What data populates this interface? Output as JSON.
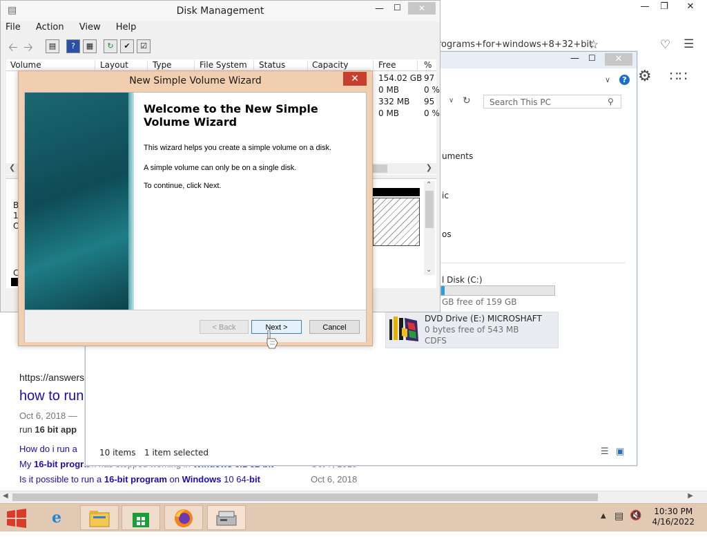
{
  "browser": {
    "address_tail": "rograms+for+windows+8+32+bit",
    "search_results": {
      "url": "https://answers",
      "title": "how to run",
      "date_line": "Oct 6, 2018 —",
      "snippet_start": "run",
      "snippet_bold": "16 bit app",
      "related": [
        {
          "text": "How do i run a",
          "date": ""
        },
        {
          "text_prefix": "My",
          "text_bold": "16-bit progra",
          "text_rest": "m has stopped working in",
          "text_bold2": "Windows 8.1 32-bit",
          "date": "Oct 7, 2018"
        },
        {
          "text_prefix": "Is it possible to run a",
          "text_bold": "16-bit program",
          "text_rest": "on",
          "text_bold2": "Windows",
          "text_rest2": "10 64-",
          "text_bold3": "bit",
          "date": "Oct 6, 2018"
        }
      ]
    }
  },
  "explorer": {
    "search_placeholder": "Search This PC",
    "nav_items": [
      "uments",
      "ic",
      "os"
    ],
    "drive_c": {
      "label": "l Disk (C:)",
      "free": "GB free of 159 GB",
      "used_fraction": 0.03
    },
    "dvd": {
      "label": "DVD Drive (E:) MICROSHAFT",
      "free": "0 bytes free of 543 MB",
      "fs": "CDFS"
    },
    "status": {
      "items": "10 items",
      "selected": "1 item selected"
    }
  },
  "disk_management": {
    "title": "Disk Management",
    "menu": [
      "File",
      "Action",
      "View",
      "Help"
    ],
    "columns": [
      "Volume",
      "Layout",
      "Type",
      "File System",
      "Status",
      "Capacity",
      "Free Spa...",
      "% F"
    ],
    "rows": [
      {
        "free": "154.02 GB",
        "pct": "97"
      },
      {
        "free": "0 MB",
        "pct": "0 %"
      },
      {
        "free": "332 MB",
        "pct": "95"
      },
      {
        "free": "0 MB",
        "pct": "0 %"
      }
    ],
    "graph_labels": [
      "B",
      "1",
      "O",
      "C"
    ]
  },
  "wizard": {
    "title": "New Simple Volume Wizard",
    "heading": "Welcome to the New Simple Volume Wizard",
    "para1": "This wizard helps you create a simple volume on a disk.",
    "para2": "A simple volume can only be on a single disk.",
    "para3": "To continue, click Next.",
    "back_label": "< Back",
    "next_label": "Next >",
    "cancel_label": "Cancel",
    "close_glyph": "✕"
  },
  "taskbar": {
    "time": "10:30 PM",
    "date": "4/16/2022"
  },
  "colors": {
    "wizard_frame": "#f1ceb0",
    "taskbar": "#e2c9b4",
    "link": "#1a0dab",
    "close_red": "#c7402f"
  }
}
